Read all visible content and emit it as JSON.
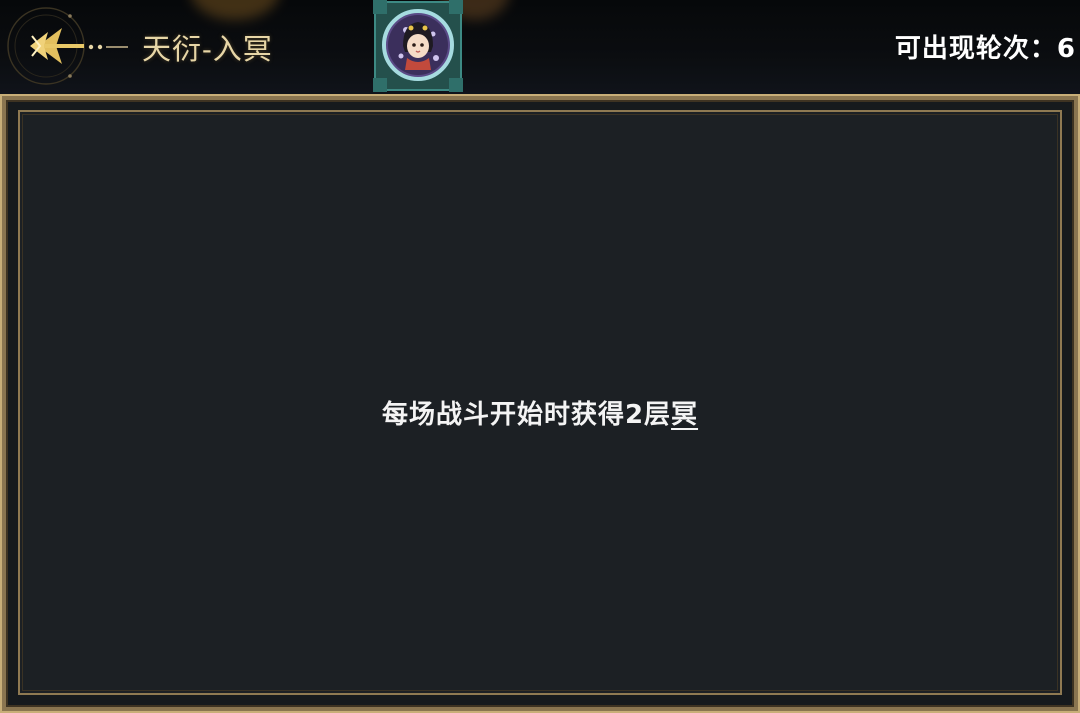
{
  "header": {
    "title": "天衍-入冥",
    "rounds_label": "可出现轮次：6"
  },
  "effect": {
    "text": "每场战斗开始时获得2层",
    "keyword": "冥"
  },
  "colors": {
    "gold": "#e7d6a6",
    "frame": "#8a7550",
    "panel_bg": "#1c2024",
    "portrait_frame": "#2f6f6a"
  },
  "icons": {
    "back": "ornate-arrow-back-icon",
    "portrait": "character-portrait-icon"
  }
}
